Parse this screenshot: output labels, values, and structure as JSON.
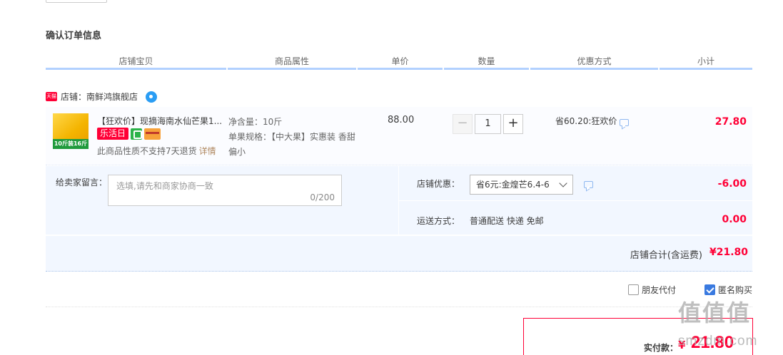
{
  "page": {
    "section_title": "确认订单信息"
  },
  "columns": [
    "店铺宝贝",
    "商品属性",
    "单价",
    "数量",
    "优惠方式",
    "小计"
  ],
  "shop": {
    "badge": "天猫",
    "name": "店铺：南鲜鸿旗舰店"
  },
  "item": {
    "thumb_label": "10斤装16斤",
    "title": "【狂欢价】现摘海南水仙芒果1...",
    "tag_label": "乐活日",
    "no_return_text": "此商品性质不支持7天退货",
    "detail_link": "详情",
    "attr_net": "净含量：10斤",
    "attr_spec": "单果规格：【中大果】实惠装 香甜偏小",
    "unit_price": "88.00",
    "qty_minus": "−",
    "qty_value": "1",
    "qty_plus": "+",
    "promo": "省60.20:狂欢价",
    "subtotal": "27.80"
  },
  "options": {
    "memo_label": "给卖家留言：",
    "memo_placeholder": "选填,请先和商家协商一致",
    "memo_count": "0/200",
    "discount_label": "店铺优惠：",
    "discount_value": "省6元:金煌芒6.4-6",
    "discount_amount": "-6.00",
    "ship_label": "运送方式：",
    "ship_value": "普通配送 快递 免邮",
    "ship_amount": "0.00"
  },
  "shop_total": {
    "label": "店铺合计(含运费)",
    "amount": "¥21.80"
  },
  "checks": {
    "friend_pay": "朋友代付",
    "friend_pay_checked": false,
    "anonymous": "匿名购买",
    "anonymous_checked": true
  },
  "payment": {
    "label": "实付款：",
    "currency": "¥",
    "amount": "21.80"
  },
  "watermark": {
    "text": "值值值",
    "url": "smzdm.com"
  },
  "colors": {
    "price_red": "#ff0036",
    "header_line": "#b2d1ff",
    "option_bg": "#f2f7ff",
    "check_blue": "#3a7ae0"
  }
}
